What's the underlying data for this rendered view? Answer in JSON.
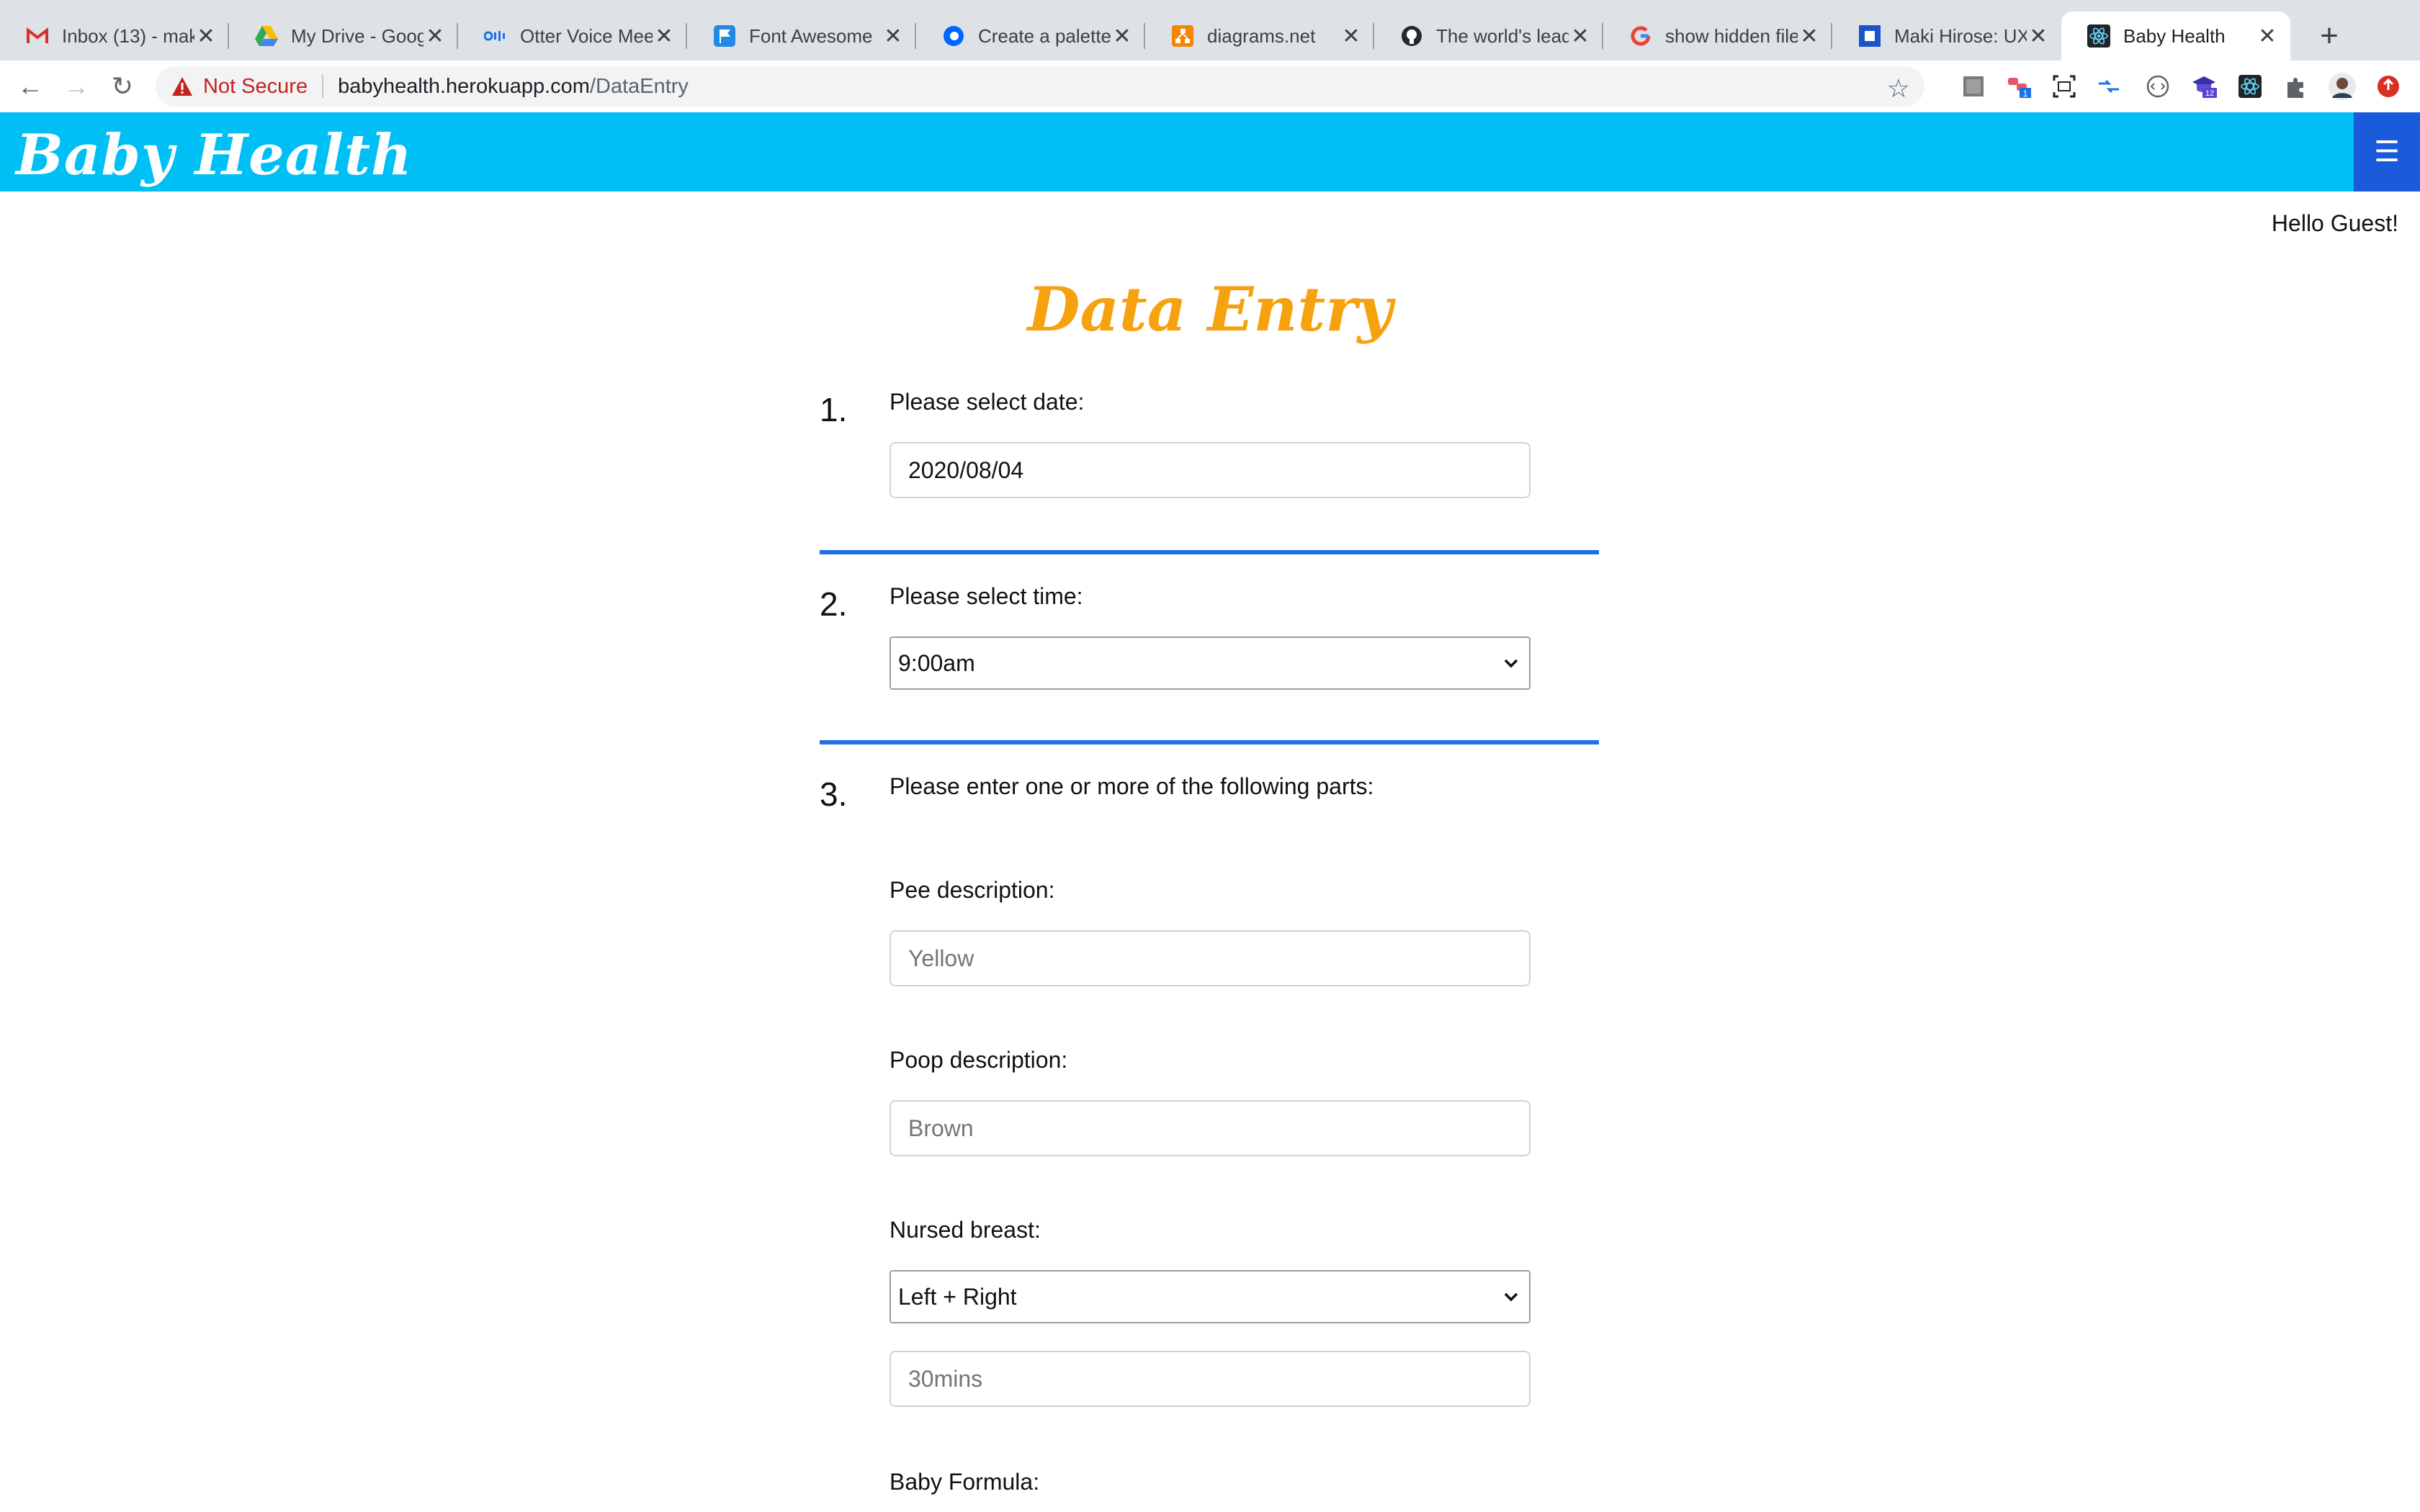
{
  "browser": {
    "tabs": [
      {
        "title": "Inbox (13) - mak",
        "icon": "gmail-icon"
      },
      {
        "title": "My Drive - Goog",
        "icon": "google-drive-icon"
      },
      {
        "title": "Otter Voice Mee",
        "icon": "otter-icon"
      },
      {
        "title": "Font Awesome",
        "icon": "font-awesome-flag-icon"
      },
      {
        "title": "Create a palette",
        "icon": "coolors-icon"
      },
      {
        "title": "diagrams.net",
        "icon": "diagrams-icon"
      },
      {
        "title": "The world's lead",
        "icon": "github-icon"
      },
      {
        "title": "show hidden file",
        "icon": "google-icon"
      },
      {
        "title": "Maki Hirose: UX",
        "icon": "portfolio-icon"
      },
      {
        "title": "Baby Health",
        "icon": "react-icon",
        "active": true
      }
    ],
    "security_label": "Not Secure",
    "url_host": "babyhealth.herokuapp.com",
    "url_path": "/DataEntry",
    "extension_badges": [
      "1",
      "12"
    ]
  },
  "app": {
    "brand": "Baby Health",
    "greeting": "Hello Guest!",
    "page_title": "Data Entry",
    "colors": {
      "navbar": "#00bff5",
      "menu_button": "#1a5bdc",
      "title": "#f6a10e",
      "divider": "#1f6fe5"
    }
  },
  "form": {
    "step1": {
      "number": "1.",
      "label": "Please select date:",
      "value": "2020/08/04"
    },
    "step2": {
      "number": "2.",
      "label": "Please select time:",
      "value": "9:00am"
    },
    "step3": {
      "number": "3.",
      "label": "Please enter one or more of the following parts:"
    },
    "pee": {
      "label": "Pee description:",
      "placeholder": "Yellow"
    },
    "poop": {
      "label": "Poop description:",
      "placeholder": "Brown"
    },
    "nursed": {
      "label": "Nursed breast:",
      "value": "Left + Right",
      "duration_placeholder": "30mins"
    },
    "formula": {
      "label": "Baby Formula:"
    }
  }
}
